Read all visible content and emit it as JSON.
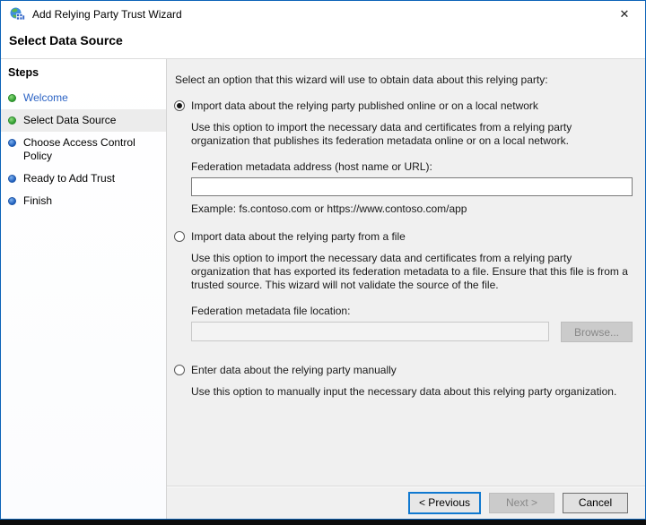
{
  "window": {
    "title": "Add Relying Party Trust Wizard",
    "close_glyph": "✕"
  },
  "page": {
    "heading": "Select Data Source"
  },
  "sidebar": {
    "heading": "Steps",
    "items": [
      {
        "label": "Welcome",
        "state": "done",
        "style": "link"
      },
      {
        "label": "Select Data Source",
        "state": "done",
        "style": "current"
      },
      {
        "label": "Choose Access Control Policy",
        "state": "todo",
        "style": "normal"
      },
      {
        "label": "Ready to Add Trust",
        "state": "todo",
        "style": "normal"
      },
      {
        "label": "Finish",
        "state": "todo",
        "style": "normal"
      }
    ]
  },
  "main": {
    "instruction": "Select an option that this wizard will use to obtain data about this relying party:",
    "option_online": {
      "label": "Import data about the relying party published online or on a local network",
      "selected": true,
      "description": "Use this option to import the necessary data and certificates from a relying party organization that publishes its federation metadata online or on a local network.",
      "field_label": "Federation metadata address (host name or URL):",
      "field_value": "",
      "example": "Example: fs.contoso.com or https://www.contoso.com/app"
    },
    "option_file": {
      "label": "Import data about the relying party from a file",
      "selected": false,
      "description": "Use this option to import the necessary data and certificates from a relying party organization that has exported its federation metadata to a file. Ensure that this file is from a trusted source.  This wizard will not validate the source of the file.",
      "field_label": "Federation metadata file location:",
      "field_value": "",
      "browse_label": "Browse..."
    },
    "option_manual": {
      "label": "Enter data about the relying party manually",
      "selected": false,
      "description": "Use this option to manually input the necessary data about this relying party organization."
    }
  },
  "footer": {
    "previous_label": "< Previous",
    "next_label": "Next >",
    "cancel_label": "Cancel"
  },
  "colors": {
    "window_border": "#0c63b8",
    "panel_gray": "#f0f0f0",
    "step_done_bullet": "#2f9e2f",
    "step_todo_bullet": "#1f5fbd",
    "link_blue": "#2b63c4",
    "focus_blue": "#1079d0",
    "selected_step_bg": "#ececec"
  }
}
